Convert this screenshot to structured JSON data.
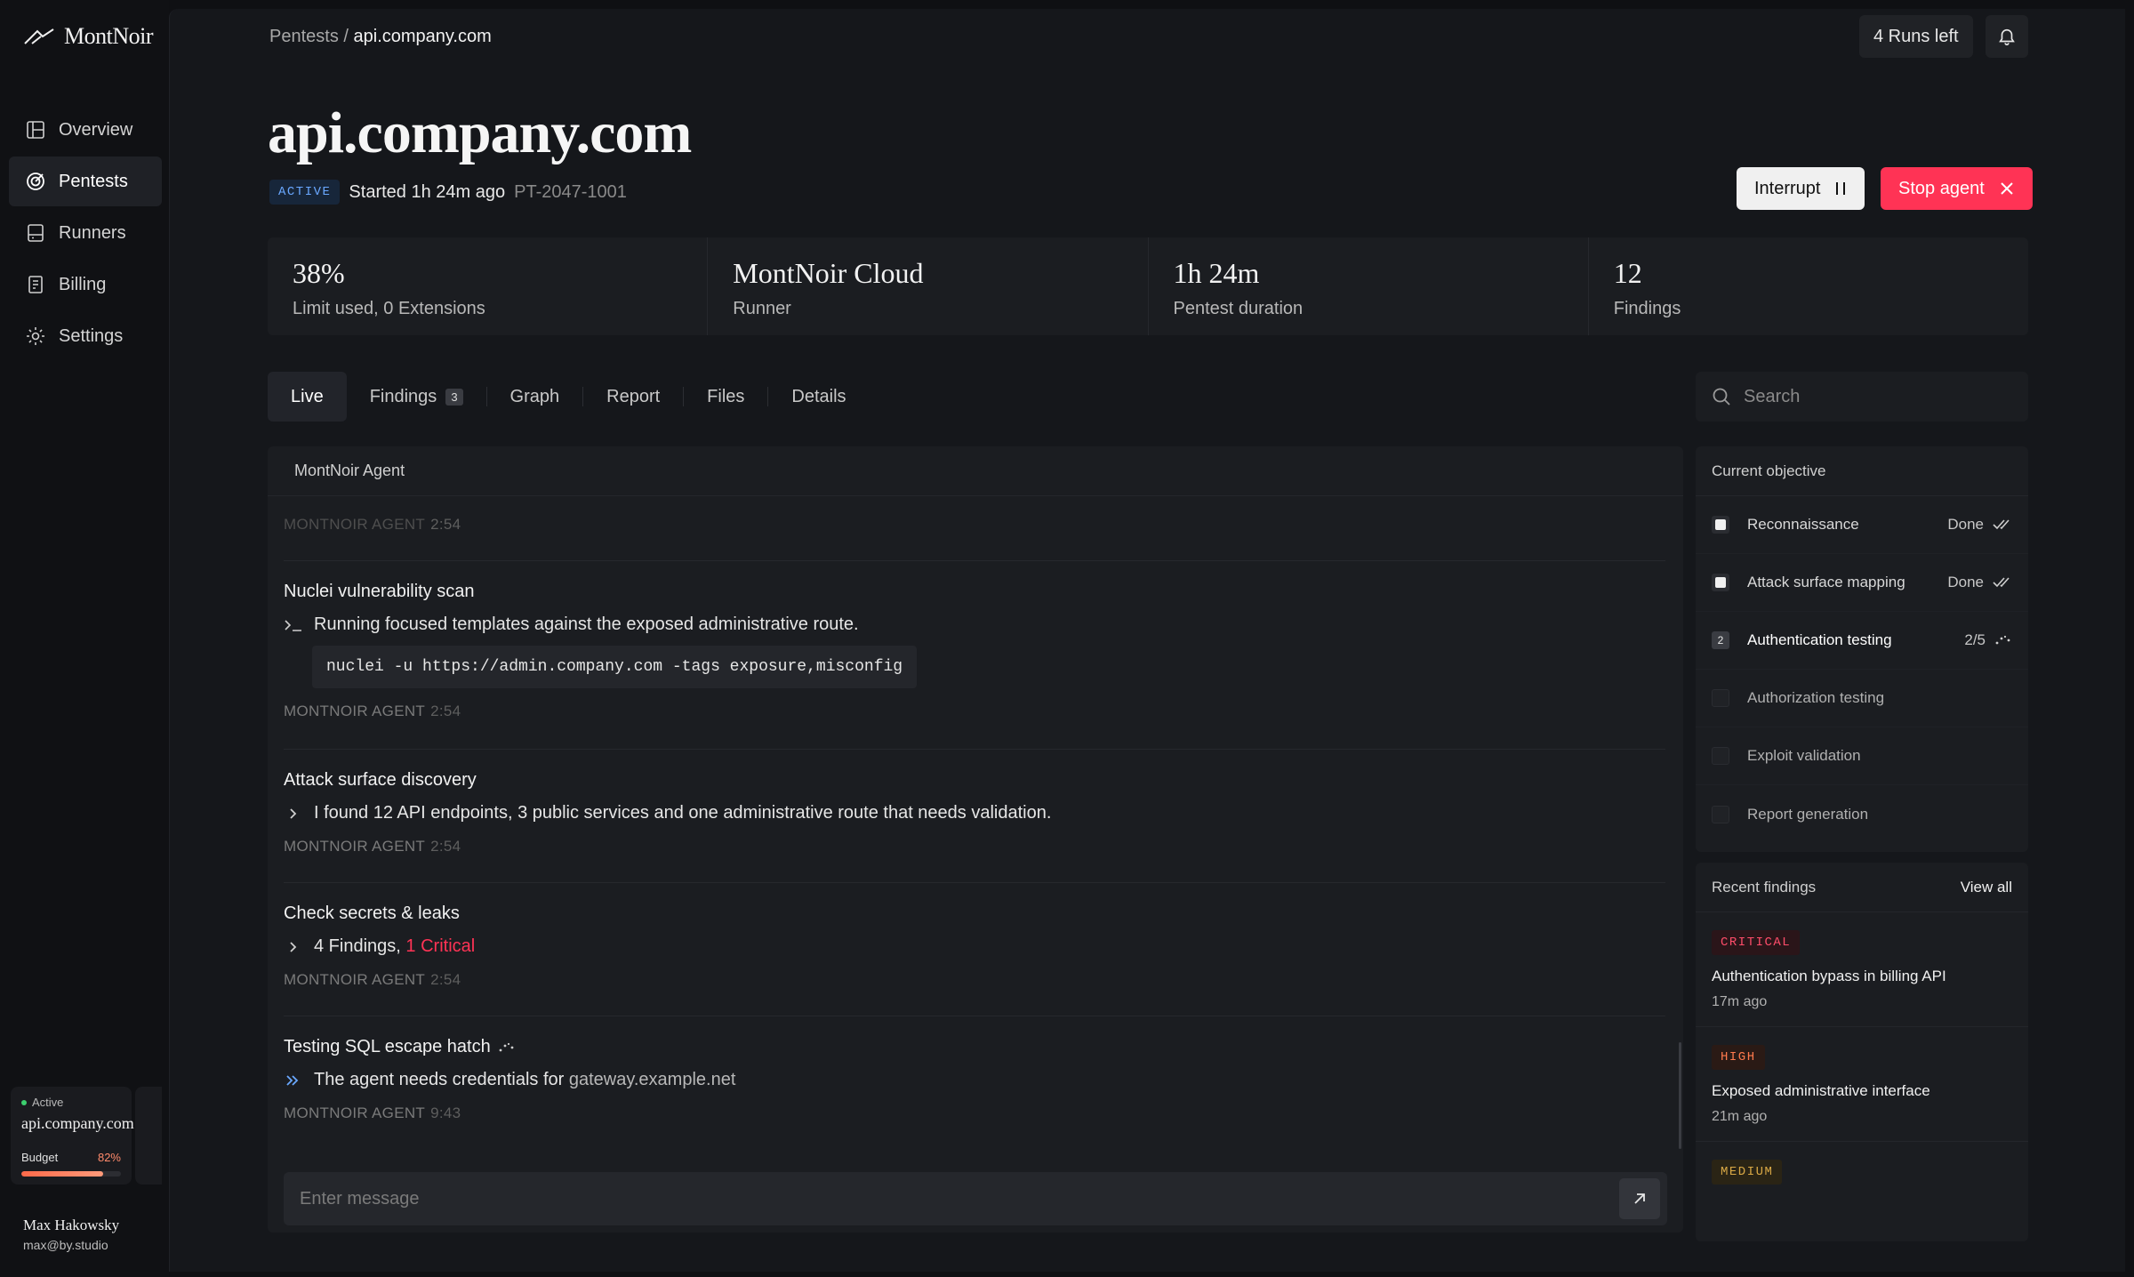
{
  "app": {
    "name": "MontNoir"
  },
  "sidebar": {
    "items": [
      {
        "label": "Overview",
        "icon": "layout-icon"
      },
      {
        "label": "Pentests",
        "icon": "target-icon",
        "active": true
      },
      {
        "label": "Runners",
        "icon": "server-icon"
      },
      {
        "label": "Billing",
        "icon": "receipt-icon"
      },
      {
        "label": "Settings",
        "icon": "gear-icon"
      }
    ],
    "runner_card": {
      "status": "Active",
      "host": "api.company.com",
      "budget_label": "Budget",
      "budget_pct": "82%",
      "budget_fraction": 0.82
    },
    "user": {
      "name": "Max Hakowsky",
      "email": "max@by.studio"
    }
  },
  "header": {
    "breadcrumb_parent": "Pentests",
    "breadcrumb_sep": " / ",
    "breadcrumb_current": "api.company.com",
    "runs_left": "4 Runs left"
  },
  "pentest": {
    "title": "api.company.com",
    "status": "ACTIVE",
    "started": "Started 1h 24m ago",
    "id": "PT-2047-1001",
    "interrupt_label": "Interrupt",
    "stop_label": "Stop agent"
  },
  "stats": [
    {
      "value": "38%",
      "label": "Limit used, 0 Extensions"
    },
    {
      "value": "MontNoir Cloud",
      "label": "Runner"
    },
    {
      "value": "1h 24m",
      "label": "Pentest duration"
    },
    {
      "value": "12",
      "label": "Findings"
    }
  ],
  "tabs": [
    {
      "label": "Live",
      "active": true
    },
    {
      "label": "Findings",
      "count": "3"
    },
    {
      "label": "Graph"
    },
    {
      "label": "Report"
    },
    {
      "label": "Files"
    },
    {
      "label": "Details"
    }
  ],
  "search": {
    "placeholder": "Search"
  },
  "feed": {
    "header": "MontNoir Agent",
    "top_meta": {
      "agent": "MONTNOIR AGENT",
      "time": "2:54"
    },
    "entries": [
      {
        "title": "Nuclei vulnerability scan",
        "line": "Running focused templates against the exposed administrative route.",
        "code": "nuclei -u https://admin.company.com -tags exposure,misconfig",
        "agent": "MONTNOIR AGENT",
        "time": "2:54"
      },
      {
        "title": "Attack surface discovery",
        "line": "I found 12 API endpoints, 3 public services and one administrative route that needs validation.",
        "agent": "MONTNOIR AGENT",
        "time": "2:54"
      },
      {
        "title": "Check secrets & leaks",
        "line": "4 Findings,",
        "line_highlight": "1 Critical",
        "agent": "MONTNOIR AGENT",
        "time": "2:54"
      },
      {
        "title": "Testing SQL escape hatch",
        "line": "The agent needs credentials for",
        "line_link": "gateway.example.net",
        "agent": "MONTNOIR AGENT",
        "time": "9:43"
      }
    ],
    "message_placeholder": "Enter message"
  },
  "objective": {
    "title": "Current objective",
    "items": [
      {
        "label": "Reconnaissance",
        "status": "Done",
        "state": "done"
      },
      {
        "label": "Attack surface mapping",
        "status": "Done",
        "state": "done"
      },
      {
        "label": "Authentication testing",
        "status": "2/5",
        "state": "current",
        "step": "2"
      },
      {
        "label": "Authorization testing",
        "status": "",
        "state": "pending"
      },
      {
        "label": "Exploit validation",
        "status": "",
        "state": "pending"
      },
      {
        "label": "Report generation",
        "status": "",
        "state": "pending"
      }
    ]
  },
  "recent_findings": {
    "title": "Recent findings",
    "view_all": "View all",
    "items": [
      {
        "severity": "CRITICAL",
        "title": "Authentication bypass in billing API",
        "time": "17m ago"
      },
      {
        "severity": "HIGH",
        "title": "Exposed administrative interface",
        "time": "21m ago"
      },
      {
        "severity": "MEDIUM"
      }
    ]
  },
  "colors": {
    "accent_red": "#ff3355",
    "active_blue": "#6aa8ff",
    "link_blue": "#6aa8ff",
    "success_green": "#3ccf6e"
  }
}
